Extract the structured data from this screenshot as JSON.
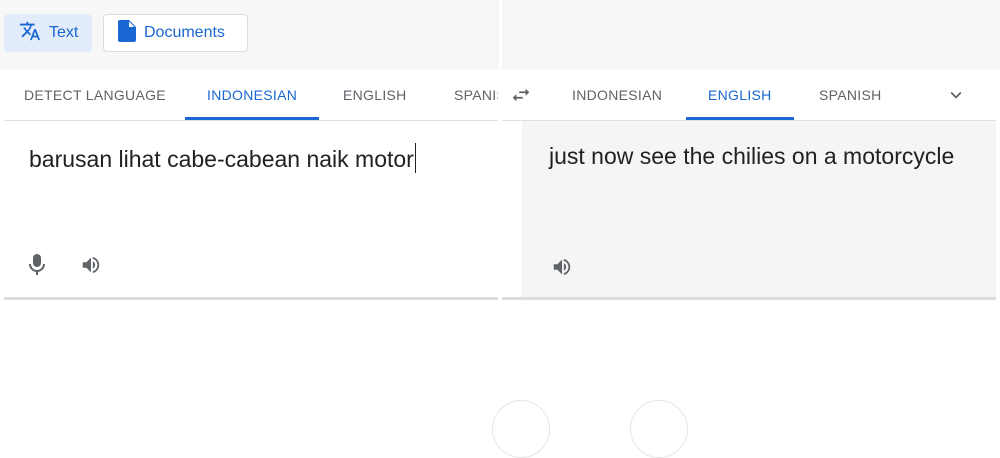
{
  "modes": {
    "text_label": "Text",
    "documents_label": "Documents"
  },
  "source": {
    "tabs": [
      "DETECT LANGUAGE",
      "INDONESIAN",
      "ENGLISH",
      "SPANIS"
    ],
    "active_tab": "INDONESIAN",
    "input_value": "barusan lihat cabe-cabean naik motor"
  },
  "target": {
    "tabs": [
      "INDONESIAN",
      "ENGLISH",
      "SPANISH"
    ],
    "active_tab": "ENGLISH",
    "output_value": "just now see the chilies on a motorcycle"
  },
  "icons": {
    "translate": "translate-icon",
    "document": "document-icon",
    "swap": "swap-languages-icon",
    "more": "chevron-down-icon",
    "mic": "microphone-icon",
    "speaker": "speaker-icon"
  },
  "colors": {
    "accent": "#1967d2",
    "active_mode_bg": "#e3ecfb",
    "tab_text": "#5f6368",
    "output_bg": "#f5f5f5"
  }
}
